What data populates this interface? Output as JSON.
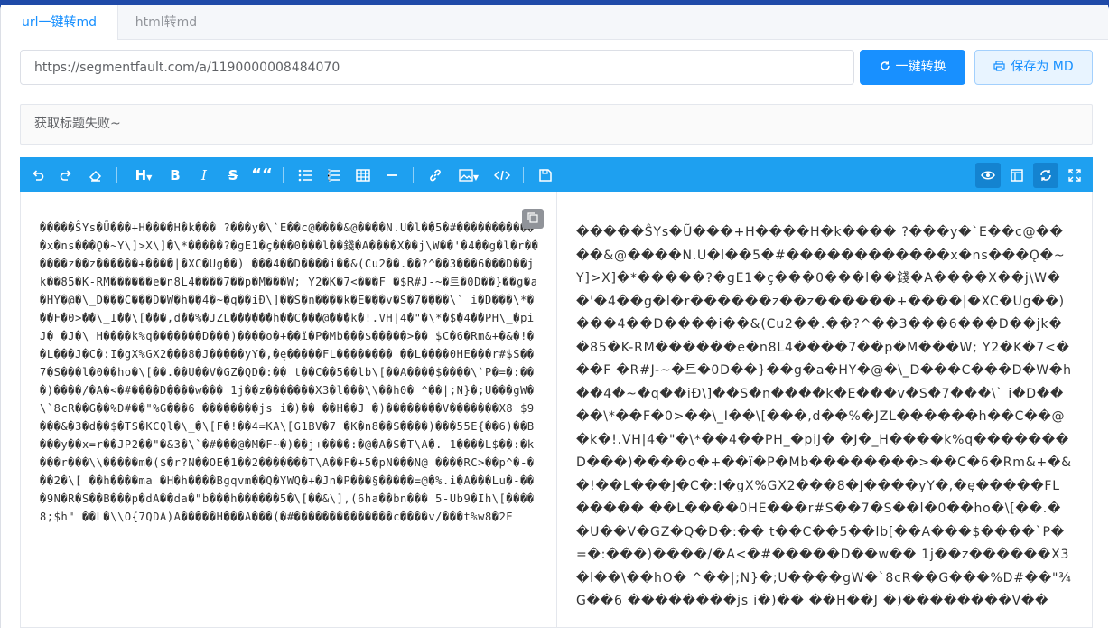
{
  "tabs": [
    {
      "label": "url一键转md"
    },
    {
      "label": "html转md"
    }
  ],
  "url_input": {
    "value": "https://segmentfault.com/a/1190000008484070"
  },
  "buttons": {
    "convert": "一键转换",
    "save": "保存为 MD"
  },
  "title_field": {
    "value": "获取标题失败~"
  },
  "toolbar": {
    "left_icons": [
      "undo-icon",
      "redo-icon",
      "eraser-icon",
      "heading-icon",
      "bold-icon",
      "italic-icon",
      "strikethrough-icon",
      "quote-icon",
      "unordered-list-icon",
      "ordered-list-icon",
      "table-icon",
      "horizontal-rule-icon",
      "link-icon",
      "image-icon",
      "code-icon",
      "save-icon"
    ],
    "right_icons": [
      "preview-eye-icon",
      "layout-icon",
      "sync-scroll-icon",
      "fullscreen-icon"
    ],
    "glyphs": {
      "heading": "H",
      "bold": "B",
      "italic": "I",
      "strike": "S",
      "quote": "““"
    }
  },
  "editor": {
    "source_text": "�����ŜYs�Ũ���+H����H�k��� ?���y�\\`E��c@����&@����N.U�l��5�#������������x�ns���Ǫ�~Y\\]>X\\]�\\*�����?�gE1�ç���0���l��錢�A����X��j\\W��'�4��g�l�r������z��z������+����|�XC�Ug��) ���4��D����i��&(Cu2��.��?^��3���6���D��jk��85�K-RM������e�n8L4����7��p�M���W; Y2�K�7<���F �$R#J-~�트�0D��}��g�a�HY�@�\\_D���C���D�W�h��4�~�q��iĐ\\]��S�n����k�E���v�S�7����\\` i�D���\\*���F�0>��\\_I��\\[���,d��%�JZL������h��C���@���k�!.VH|4�\"�\\*�$�4��PH\\_�piJ� �J�\\_H����k%q�������D���)����o�+��ï�P�Mb���$�����>�� $C�6�Rm&+�&�!��L���J�C�:I�gX%GX2���8�J�����yY�,�ę�����FL�������� ��L����0HE���r#$S��7�S���l�0��ho�\\[��.��U��V�GZ�QD�:�� t��C��5��lb\\[��A����$����\\`P�=�:���)����/�A�<�#����D����w��� 1j��z�������X3�l���\\\\��h0� ^��|;N}�;U���gW�\\`8cR��G��%D#��\"%G���6 ��������js i�)�� ��H��J �)��������V�������X8 $9���&�3�d��$�TS�KCQl�\\_�\\[F�!��4=KA\\[G1BV�7 �K�n8��S����)���55E{��6)��B���y��x=r��JP2��\"�&3�\\`�#���@�M�F~�)��j+����:�@�A�S�T\\A�. 1����L$��:�k���r���\\\\�����m�($�r?N��OE�1��2�������T\\A��F�+5�pN���N@ ����RC>��p^�-���2�\\[ ��h����ma �H�h����Bgqvm��Q�YWQ�+�Jn�P���§�����=@�%.i�A���Lu�-���9N�R�S��B���p�dA��da�\"b���h������5�\\[��&\\],(6ha��bn��� 5-Ub9�Ih\\[����8;$h\" ��L�\\\\O{7QDA)A�����H���A���(�#��������������c����v/���t%w8�2E",
    "preview_text": "�����ŜYs�Ũ���+H����H�k���� ?���y�`E��c@����&@����N.U�l��5�#������������x�ns���Ǫ�~Y]>X]�*�����?�gE1�ç���0���l��錢�A����X��j\\W��'�4��g�l�r������z��z������+����|�XC�Ug��)���4��D����i��&(Cu2��.��?^��3���6���D��jk��85�K-RM������e�n8L4����7��p�M���W; Y2�K�7<���F �R#J-~�트�0D��}��g�a�HY�@�\\_D���C���D�W�h��4�~�q��iĐ\\]��S�n����k�E���v�S�7���\\` i�D����\\*��F�0>��\\_I��\\[���,d��%�JZL������h��C��@�k�!.VH|4�\"�\\*��4��PH_�piJ� �J�_H����k%q�������D���)����o�+��ï�P�Mb��������>��C�6�Rm&+�&�!��L���J�C�:I�gX%GX2���8�J����yY�,�ę�����FL����� ��L����0HE���r#S��7�S��l�0��ho�\\[��.��U��V�GZ�Q�D�:�� t��C��5��lb[��A���$����`P�=�:���)����/�A<�#�����D��w�� 1j��z������X3�l��\\��hO� ^��|;N}�;U����gW�`8cR��G���%D#��\"¾G��6 ��������js i�)�� ��H��J �)��������V��"
  },
  "colors": {
    "accent": "#1890ff",
    "toolbar_bg": "#1ea0f0",
    "top_band": "#1f4aa8"
  }
}
